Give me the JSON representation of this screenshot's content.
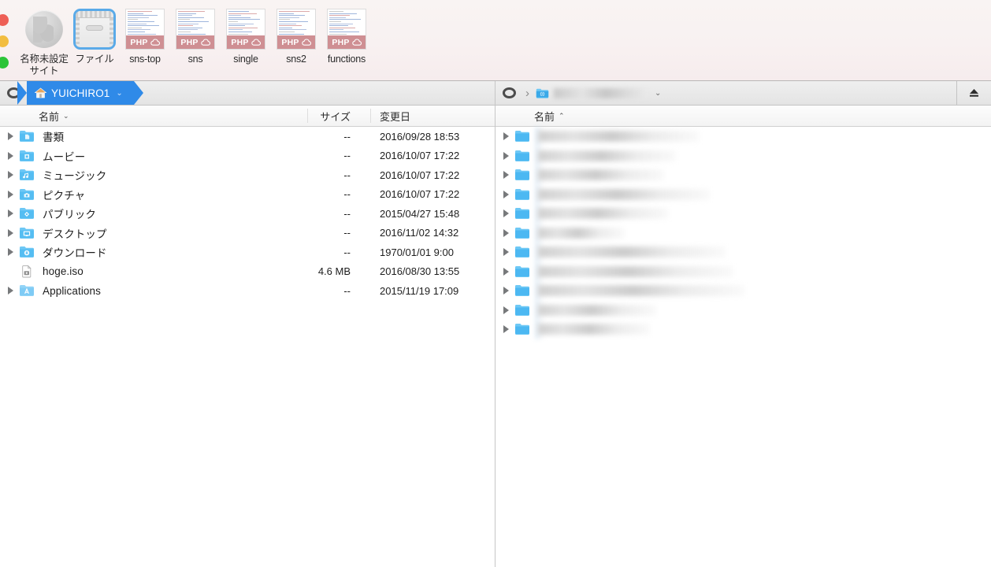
{
  "window": {
    "traffic_lights": [
      {
        "name": "close",
        "color": "#ee5f56"
      },
      {
        "name": "minimize",
        "color": "#f2bd40"
      },
      {
        "name": "zoom",
        "color": "#2cc438"
      }
    ]
  },
  "tabbar": {
    "tabs": [
      {
        "label": "名称未設定サイト",
        "kind": "site",
        "selected": false
      },
      {
        "label": "ファイル",
        "kind": "files",
        "selected": true
      },
      {
        "label": "sns-top",
        "kind": "php",
        "badge": "PHP",
        "selected": false
      },
      {
        "label": "sns",
        "kind": "php",
        "badge": "PHP",
        "selected": false
      },
      {
        "label": "single",
        "kind": "php",
        "badge": "PHP",
        "selected": false
      },
      {
        "label": "sns2",
        "kind": "php",
        "badge": "PHP",
        "selected": false
      },
      {
        "label": "functions",
        "kind": "php",
        "badge": "PHP",
        "selected": false
      }
    ]
  },
  "left_pane": {
    "path": {
      "root_icon": "disk-ring-icon",
      "crumb_icon": "home-icon",
      "crumb_label": "YUICHIRO1",
      "chevron": "⌄"
    },
    "columns": {
      "name": "名前",
      "name_sort": "⌄",
      "size": "サイズ",
      "date": "変更日"
    },
    "rows": [
      {
        "name": "書類",
        "icon": "folder-documents-icon",
        "size": "--",
        "date": "2016/09/28 18:53",
        "expandable": true
      },
      {
        "name": "ムービー",
        "icon": "folder-movies-icon",
        "size": "--",
        "date": "2016/10/07 17:22",
        "expandable": true
      },
      {
        "name": "ミュージック",
        "icon": "folder-music-icon",
        "size": "--",
        "date": "2016/10/07 17:22",
        "expandable": true
      },
      {
        "name": "ピクチャ",
        "icon": "folder-pictures-icon",
        "size": "--",
        "date": "2016/10/07 17:22",
        "expandable": true
      },
      {
        "name": "パブリック",
        "icon": "folder-public-icon",
        "size": "--",
        "date": "2015/04/27 15:48",
        "expandable": true
      },
      {
        "name": "デスクトップ",
        "icon": "folder-desktop-icon",
        "size": "--",
        "date": "2016/11/02 14:32",
        "expandable": true
      },
      {
        "name": "ダウンロード",
        "icon": "folder-downloads-icon",
        "size": "--",
        "date": "1970/01/01 9:00",
        "expandable": true
      },
      {
        "name": "hoge.iso",
        "icon": "disk-image-file-icon",
        "size": "4.6 MB",
        "date": "2016/08/30 13:55",
        "expandable": false
      },
      {
        "name": "Applications",
        "icon": "folder-applications-icon",
        "size": "--",
        "date": "2015/11/19 17:09",
        "expandable": true
      }
    ]
  },
  "right_pane": {
    "path": {
      "root_icon": "disk-ring-icon",
      "separator": "›",
      "crumb_icon": "server-folder-icon",
      "crumb_label_redacted": true,
      "chevron": "⌄"
    },
    "eject_icon": "eject-icon",
    "columns": {
      "name": "名前",
      "name_sort": "⌃"
    },
    "rows": [
      {
        "icon": "folder-icon",
        "redacted": true,
        "blur_width": 205
      },
      {
        "icon": "folder-icon",
        "redacted": true,
        "blur_width": 175
      },
      {
        "icon": "folder-icon",
        "redacted": true,
        "blur_width": 160
      },
      {
        "icon": "folder-icon",
        "redacted": true,
        "blur_width": 218
      },
      {
        "icon": "folder-icon",
        "redacted": true,
        "blur_width": 166
      },
      {
        "icon": "folder-icon",
        "redacted": true,
        "blur_width": 110
      },
      {
        "icon": "folder-icon",
        "redacted": true,
        "blur_width": 238
      },
      {
        "icon": "folder-icon",
        "redacted": true,
        "blur_width": 248
      },
      {
        "icon": "folder-icon",
        "redacted": true,
        "blur_width": 262
      },
      {
        "icon": "folder-icon",
        "redacted": true,
        "blur_width": 150
      },
      {
        "icon": "folder-icon",
        "redacted": true,
        "blur_width": 142
      }
    ]
  }
}
